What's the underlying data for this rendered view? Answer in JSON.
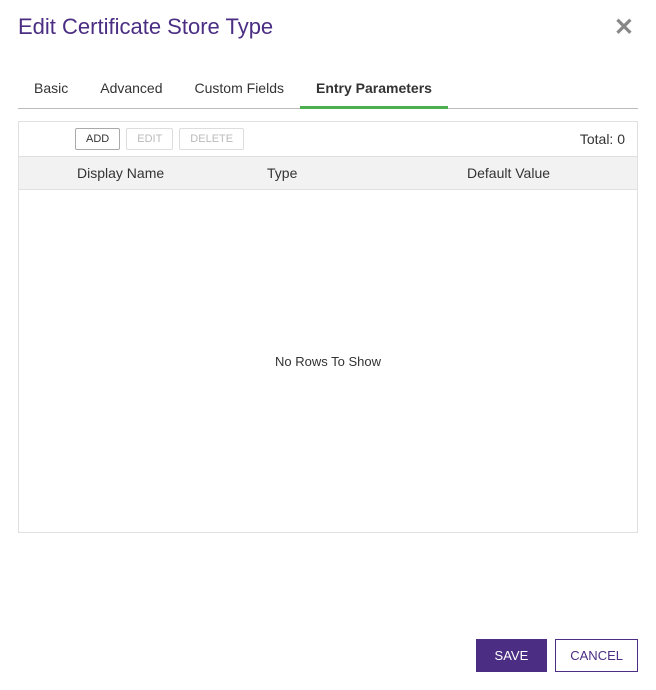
{
  "dialog": {
    "title": "Edit Certificate Store Type"
  },
  "tabs": {
    "items": [
      {
        "label": "Basic"
      },
      {
        "label": "Advanced"
      },
      {
        "label": "Custom Fields"
      },
      {
        "label": "Entry Parameters"
      }
    ],
    "active_index": 3
  },
  "toolbar": {
    "add_label": "ADD",
    "edit_label": "EDIT",
    "delete_label": "DELETE",
    "total_label": "Total: 0"
  },
  "table": {
    "columns": {
      "display_name": "Display Name",
      "type": "Type",
      "default_value": "Default Value"
    },
    "empty_message": "No Rows To Show"
  },
  "footer": {
    "save_label": "SAVE",
    "cancel_label": "CANCEL"
  }
}
